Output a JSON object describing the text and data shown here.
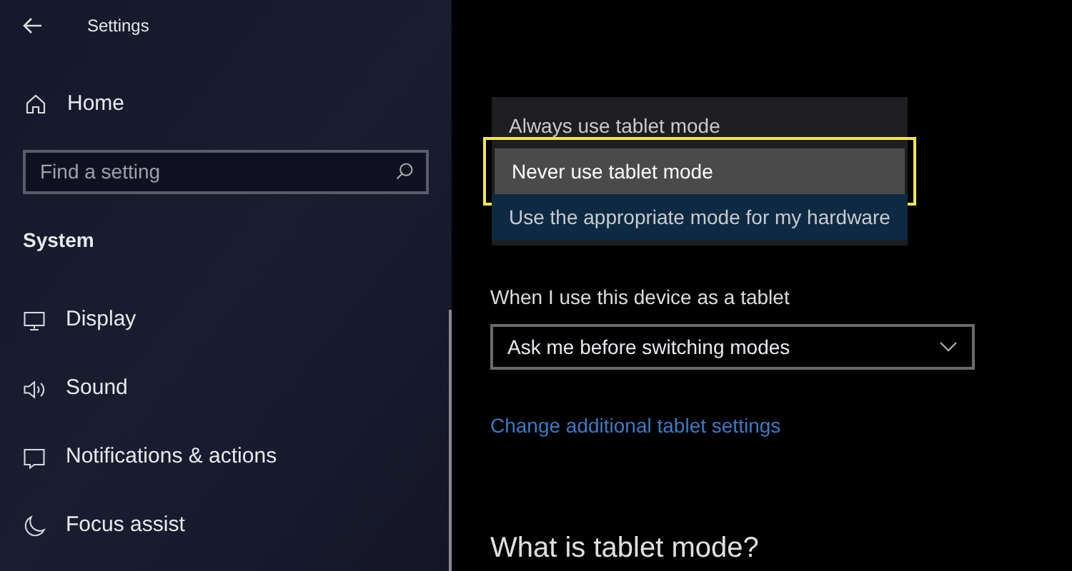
{
  "window": {
    "title": "Settings"
  },
  "sidebar": {
    "home": "Home",
    "search": {
      "placeholder": "Find a setting"
    },
    "section": "System",
    "items": [
      {
        "label": "Display"
      },
      {
        "label": "Sound"
      },
      {
        "label": "Notifications & actions"
      },
      {
        "label": "Focus assist"
      }
    ]
  },
  "mode_menu": {
    "options": [
      {
        "label": "Always use tablet mode",
        "selected": false,
        "hovered": false,
        "outlined": false
      },
      {
        "label": "Never use tablet mode",
        "selected": false,
        "hovered": true,
        "outlined": true
      },
      {
        "label": "Use the appropriate mode for my hardware",
        "selected": true,
        "hovered": false,
        "outlined": false
      }
    ]
  },
  "tablet_setting": {
    "label": "When I use this device as a tablet",
    "value": "Ask me before switching modes"
  },
  "link": "Change additional tablet settings",
  "heading": "What is tablet mode?"
}
